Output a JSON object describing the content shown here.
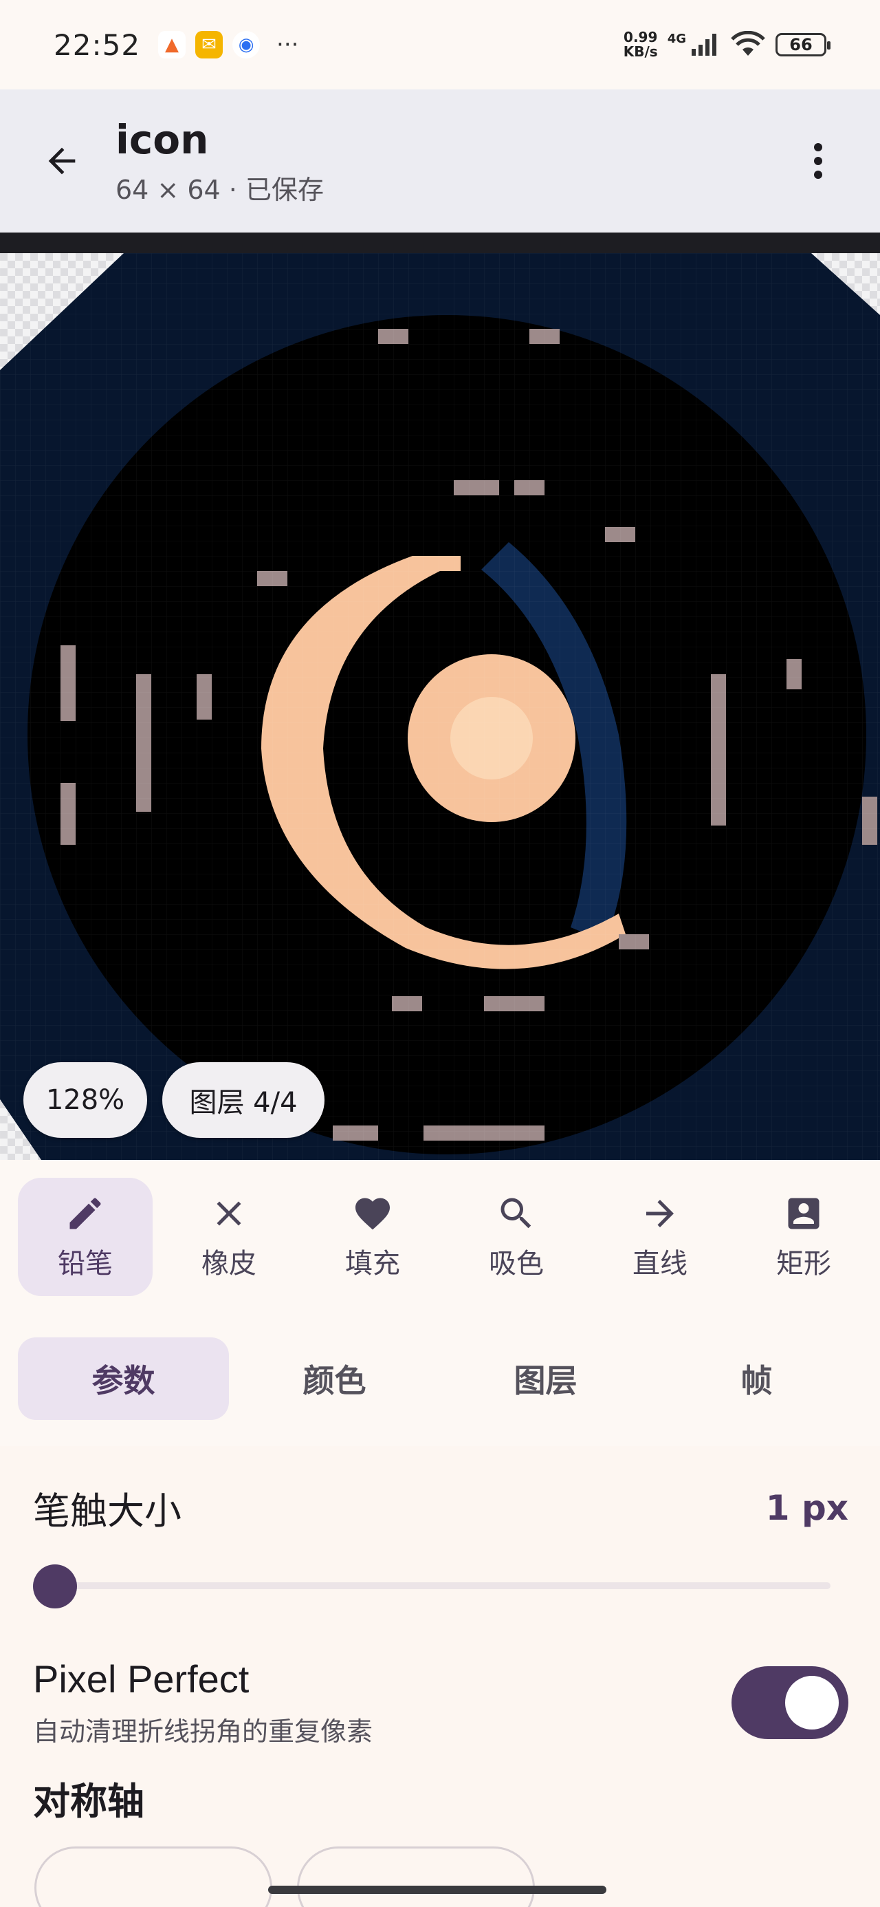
{
  "status_bar": {
    "time": "22:52",
    "notifications": [
      {
        "icon": "app-notification-icon",
        "color": "#f06a2b"
      },
      {
        "icon": "mail-icon",
        "color": "#f5b500"
      },
      {
        "icon": "browser-icon",
        "color": "#2b6ff2"
      }
    ],
    "more": "···",
    "speed_value": "0.99",
    "speed_unit": "KB/s",
    "network": "4G",
    "battery": "66"
  },
  "app_bar": {
    "title": "icon",
    "subtitle": "64 × 64 · 已保存"
  },
  "canvas": {
    "zoom_label": "128%",
    "layer_label": "图层 4/4"
  },
  "tools": [
    {
      "label": "铅笔",
      "icon": "pencil-icon",
      "active": true
    },
    {
      "label": "橡皮",
      "icon": "close-icon",
      "active": false
    },
    {
      "label": "填充",
      "icon": "heart-icon",
      "active": false
    },
    {
      "label": "吸色",
      "icon": "search-icon",
      "active": false
    },
    {
      "label": "直线",
      "icon": "arrow-right-icon",
      "active": false
    },
    {
      "label": "矩形",
      "icon": "person-box-icon",
      "active": false
    }
  ],
  "tabs": [
    {
      "label": "参数",
      "active": true
    },
    {
      "label": "颜色",
      "active": false
    },
    {
      "label": "图层",
      "active": false
    },
    {
      "label": "帧",
      "active": false
    }
  ],
  "params": {
    "brush_size_label": "笔触大小",
    "brush_size_value": "1 px",
    "brush_size_level": 0.0,
    "pixel_perfect_title": "Pixel Perfect",
    "pixel_perfect_desc": "自动清理折线拐角的重复像素",
    "pixel_perfect_on": true,
    "symmetry_title": "对称轴"
  },
  "colors": {
    "accent": "#4f3a64",
    "accent_container": "#ebe3f0",
    "canvas_bg": "#0a1a33",
    "moon": "#f7c39c"
  }
}
